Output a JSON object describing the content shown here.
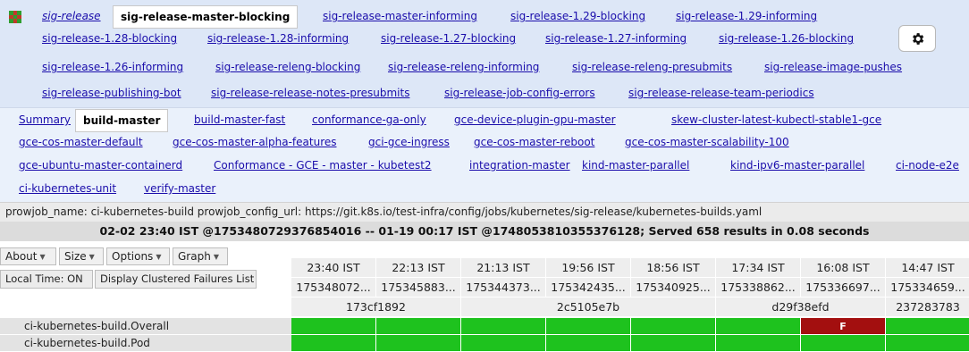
{
  "group_tabs": {
    "items": [
      {
        "label": "sig-release",
        "italic": true
      },
      {
        "label": "sig-release-master-blocking",
        "selected": true
      },
      {
        "label": "sig-release-master-informing"
      },
      {
        "label": "sig-release-1.29-blocking"
      },
      {
        "label": "sig-release-1.29-informing"
      },
      {
        "label": "sig-release-1.28-blocking"
      },
      {
        "label": "sig-release-1.28-informing"
      },
      {
        "label": "sig-release-1.27-blocking"
      },
      {
        "label": "sig-release-1.27-informing"
      },
      {
        "label": "sig-release-1.26-blocking"
      },
      {
        "label": "sig-release-1.26-informing"
      },
      {
        "label": "sig-release-releng-blocking"
      },
      {
        "label": "sig-release-releng-informing"
      },
      {
        "label": "sig-release-releng-presubmits"
      },
      {
        "label": "sig-release-image-pushes"
      },
      {
        "label": "sig-release-publishing-bot"
      },
      {
        "label": "sig-release-release-notes-presubmits"
      },
      {
        "label": "sig-release-job-config-errors"
      },
      {
        "label": "sig-release-release-team-periodics"
      }
    ]
  },
  "dashboard_tabs": {
    "items": [
      {
        "label": "Summary"
      },
      {
        "label": "build-master",
        "selected": true
      },
      {
        "label": "build-master-fast"
      },
      {
        "label": "conformance-ga-only"
      },
      {
        "label": "gce-device-plugin-gpu-master"
      },
      {
        "label": "skew-cluster-latest-kubectl-stable1-gce"
      },
      {
        "label": "gce-cos-master-default"
      },
      {
        "label": "gce-cos-master-alpha-features"
      },
      {
        "label": "gci-gce-ingress"
      },
      {
        "label": "gce-cos-master-reboot"
      },
      {
        "label": "gce-cos-master-scalability-100"
      },
      {
        "label": "gce-ubuntu-master-containerd"
      },
      {
        "label": "Conformance - GCE - master - kubetest2"
      },
      {
        "label": "integration-master"
      },
      {
        "label": "kind-master-parallel"
      },
      {
        "label": "kind-ipv6-master-parallel"
      },
      {
        "label": "ci-node-e2e"
      },
      {
        "label": "ci-kubernetes-unit"
      },
      {
        "label": "verify-master"
      }
    ]
  },
  "info": {
    "config_line": "prowjob_name: ci-kubernetes-build prowjob_config_url: https://git.k8s.io/test-infra/config/jobs/kubernetes/sig-release/kubernetes-builds.yaml",
    "status_line": "02-02 23:40 IST @1753480729376854016 -- 01-19 00:17 IST @1748053810355376128; Served 658 results in 0.08 seconds"
  },
  "controls": {
    "about": "About",
    "size": "Size",
    "options": "Options",
    "graph": "Graph",
    "local_time": "Local Time: ON",
    "clustered": "Display Clustered Failures List"
  },
  "grid": {
    "columns": [
      {
        "time": "23:40 IST",
        "build": "175348072..."
      },
      {
        "time": "22:13 IST",
        "build": "175345883..."
      },
      {
        "time": "21:13 IST",
        "build": "175344373..."
      },
      {
        "time": "19:56 IST",
        "build": "175342435..."
      },
      {
        "time": "18:56 IST",
        "build": "175340925..."
      },
      {
        "time": "17:34 IST",
        "build": "175338862..."
      },
      {
        "time": "16:08 IST",
        "build": "175336697..."
      },
      {
        "time": "14:47 IST",
        "build": "175334659..."
      }
    ],
    "commits": [
      {
        "label": "173cf1892",
        "span": 2
      },
      {
        "label": "2c5105e7b",
        "span": 3
      },
      {
        "label": "d29f38efd",
        "span": 2
      },
      {
        "label": "237283783",
        "span": 1
      }
    ],
    "rows": [
      {
        "name": "ci-kubernetes-build.Overall",
        "results": [
          "pass",
          "pass",
          "pass",
          "pass",
          "pass",
          "pass",
          "fail",
          "pass"
        ],
        "fail_text": "F"
      },
      {
        "name": "ci-kubernetes-build.Pod",
        "results": [
          "pass",
          "pass",
          "pass",
          "pass",
          "pass",
          "pass",
          "pass",
          "pass"
        ]
      }
    ]
  },
  "colors": {
    "pass": "#1ec21e",
    "fail": "#a30f0f"
  }
}
